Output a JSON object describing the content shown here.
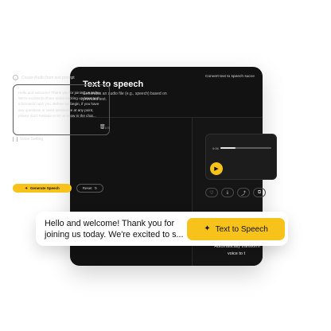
{
  "app": {
    "title": "Text to speech",
    "subtitle": "Generates an audio file (e.g., speech) based on provided text."
  },
  "left_panel": {
    "step_number": "1",
    "step_label": "Create Audio from text prompt",
    "prompt_text": "Hello and welcome! Thank you for joining us today. We're excited to share some exciting updates and information with you. Before we begin, if you have any questions or need assistance at any point, please don't hesitate to let us know in the chat...",
    "char_count": "90/100",
    "voice_label": "Voice Setting",
    "generate_label": "Generate Speech",
    "reset_label": "Reset"
  },
  "right_panel": {
    "title": "Convert text to speech succe",
    "time_current": "0:06",
    "progress": 0.3,
    "quote": "\"Automatically transform voice to t"
  },
  "overlay": {
    "text": "Hello and welcome! Thank you for joining us today. We're excited to s...",
    "button_label": "Text to Speech"
  },
  "colors": {
    "accent": "#f7c21a",
    "panel_bg": "#121212"
  },
  "icons": {
    "play": "play-icon",
    "trash": "trash-icon",
    "spark": "sparkle-icon",
    "reset": "reset-icon"
  }
}
